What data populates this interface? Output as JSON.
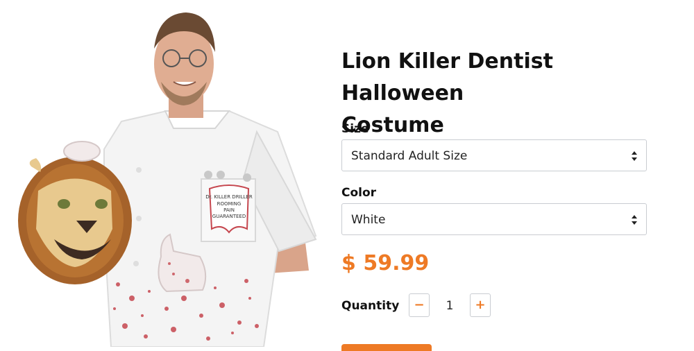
{
  "product": {
    "title_line1": "Lion Killer Dentist Halloween",
    "title_line2": "Costume",
    "price": "$ 59.99"
  },
  "size": {
    "label": "Size",
    "selected": "Standard Adult Size"
  },
  "color": {
    "label": "Color",
    "selected": "White"
  },
  "quantity": {
    "label": "Quantity",
    "value": "1",
    "decrement": "−",
    "increment": "+"
  },
  "photo": {
    "pocket_text_1": "Dr. KILLER DRILLER",
    "pocket_text_2": "ROOMING",
    "pocket_text_3": "PAIN",
    "pocket_text_4": "GUARANTEED"
  },
  "colors": {
    "accent": "#ee7a25",
    "border": "#c9ccd1",
    "text": "#111111"
  }
}
